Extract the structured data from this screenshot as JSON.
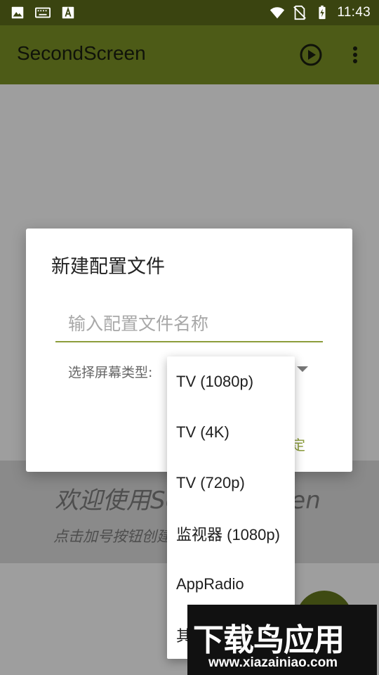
{
  "status_bar": {
    "time": "11:43",
    "icons": [
      "image-icon",
      "keyboard-icon",
      "text-a-icon",
      "wifi-icon",
      "no-sim-icon",
      "battery-charging-icon"
    ]
  },
  "app_bar": {
    "title": "SecondScreen",
    "actions": [
      "play-circle-icon",
      "more-vert-icon"
    ]
  },
  "empty_state": {
    "title": "欢迎使用SecondScreen",
    "subtitle": "点击加号按钮创建新的配置文件"
  },
  "dialog": {
    "title": "新建配置文件",
    "name_input": {
      "value": "",
      "placeholder": "输入配置文件名称"
    },
    "screen_type_label": "选择屏幕类型:",
    "ok_label": "确定"
  },
  "dropdown": {
    "options": [
      "TV (1080p)",
      "TV (4K)",
      "TV (720p)",
      "监视器 (1080p)",
      "AppRadio",
      "其他"
    ]
  },
  "watermark": {
    "logo_text": "下载鸟应用",
    "url": "www.xiazainiao.com"
  },
  "colors": {
    "status_bar": "#3a4410",
    "app_bar": "#4d5b17",
    "accent": "#8c9d3b",
    "scrim_background": "#9e9e9e"
  }
}
